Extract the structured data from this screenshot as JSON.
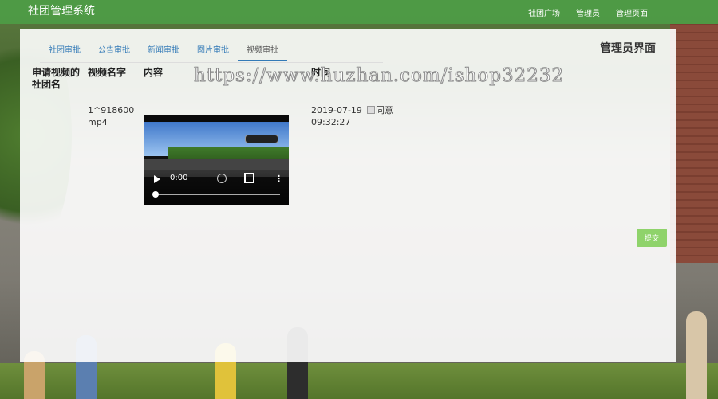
{
  "app": {
    "title": "社团管理系统",
    "nav": [
      "社团广场",
      "管理员",
      "管理页面"
    ]
  },
  "panel": {
    "title": "管理员界面",
    "tabs": [
      "社团审批",
      "公告审批",
      "新闻审批",
      "图片审批",
      "视频审批"
    ],
    "active_tab": "视频审批"
  },
  "watermark": "https://www.huzhan.com/ishop32232",
  "table": {
    "headers": [
      "申请视频的社团名",
      "视频名字",
      "内容",
      "",
      "时间",
      ""
    ],
    "rows": [
      {
        "club": "",
        "video_name": "1^918600 mp4",
        "video_time": "0:00",
        "date": "2019-07-19",
        "time": "09:32:27",
        "approve_label": "同意"
      }
    ]
  },
  "submit_label": "提交",
  "icons": {
    "play": "play-icon",
    "volume": "volume-icon",
    "fullscreen": "fullscreen-icon",
    "more": "more-vertical-icon",
    "checkbox": "checkbox-icon"
  }
}
